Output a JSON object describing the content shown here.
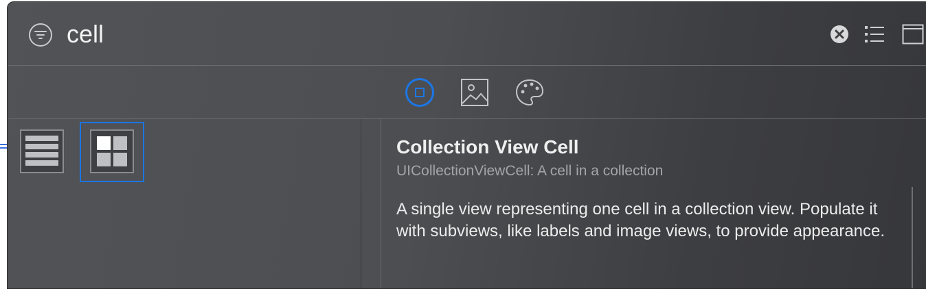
{
  "search": {
    "value": "cell",
    "placeholder": "Filter"
  },
  "toolbar": {
    "clear_icon": "clear-icon",
    "list_view_icon": "list-icon",
    "panel_icon": "panel-icon",
    "filter_icon": "filter-icon"
  },
  "tabs": [
    {
      "name": "objects",
      "icon": "square-in-circle-icon",
      "selected": true
    },
    {
      "name": "media",
      "icon": "image-icon",
      "selected": false
    },
    {
      "name": "colors",
      "icon": "palette-icon",
      "selected": false
    }
  ],
  "library": {
    "items": [
      {
        "name": "table-view-cell",
        "icon": "table-cell-icon",
        "selected": false
      },
      {
        "name": "collection-view-cell",
        "icon": "collection-cell-icon",
        "selected": true
      }
    ]
  },
  "detail": {
    "title": "Collection View Cell",
    "subtitle": "UICollectionViewCell: A cell in a collection",
    "description": "A single view representing one cell in a collection view. Populate it with subviews, like labels and image views, to provide appearance."
  },
  "colors": {
    "accent": "#1c76e6",
    "panel_bg": "#4c4e52",
    "text": "#efefef",
    "subtext": "#a3a5a9"
  }
}
